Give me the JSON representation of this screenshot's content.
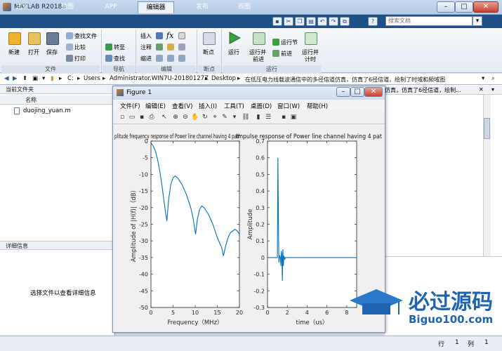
{
  "window": {
    "title": "MATLAB R2018a",
    "minimize": "–",
    "maximize": "□",
    "close": "✕"
  },
  "tabs": [
    {
      "label": "主页"
    },
    {
      "label": "绘图"
    },
    {
      "label": "APP"
    },
    {
      "label": "编辑器"
    },
    {
      "label": "发布"
    },
    {
      "label": "视图"
    }
  ],
  "search": {
    "placeholder": "搜索文档",
    "go": "▾"
  },
  "toolstrip_icons": [
    "save-icon",
    "cut-icon",
    "copy-icon",
    "paste-icon",
    "undo-icon",
    "redo-icon",
    "switch-window-icon",
    "help-icon"
  ],
  "ribbon": {
    "file": {
      "new": "新建",
      "open": "打开",
      "save": "保存",
      "find_files": "查找文件",
      "compare": "比较",
      "print": "打印",
      "section": "文件"
    },
    "navigate": {
      "goto": "转至",
      "find": "查找",
      "section": "导航"
    },
    "edit": {
      "insert": "插入",
      "comment": "注释",
      "indent": "缩进",
      "fx": "fx",
      "section": "编辑"
    },
    "breakpoints": {
      "label": "断点",
      "section": "断点"
    },
    "run": {
      "run": "运行",
      "run_advance_1": "运行并",
      "run_advance_2": "前进",
      "run_section": "运行节",
      "advance": "前进",
      "run_time_1": "运行并",
      "run_time_2": "计时",
      "section": "运行"
    }
  },
  "address": {
    "drive": "C:",
    "users": "Users",
    "user": "Administrator.WIN7U-20180127Z",
    "desktop": "Desktop",
    "folder": "在低压电力线载波通信中的多径信道仿真，仿真了6径信道，绘制了时域和频域图"
  },
  "current_folder": {
    "title": "当前文件夹",
    "column_name": "名称",
    "files": [
      {
        "name": "duojing_yuan.m"
      }
    ]
  },
  "details": {
    "title": "详细信息",
    "empty": "选择文件以查看详细信息"
  },
  "right_panel": {
    "text": "仿真，仿真了6径信道，绘制..."
  },
  "status": {
    "row_label": "行",
    "row_value": "1",
    "col_label": "列",
    "col_value": "1"
  },
  "figure": {
    "title": "Figure 1",
    "menu": [
      {
        "label": "文件(F)"
      },
      {
        "label": "编辑(E)"
      },
      {
        "label": "查看(V)"
      },
      {
        "label": "插入(I)"
      },
      {
        "label": "工具(T)"
      },
      {
        "label": "桌面(D)"
      },
      {
        "label": "窗口(W)"
      },
      {
        "label": "帮助(H)"
      }
    ]
  },
  "watermark": {
    "text": "必过源码",
    "url": "Biguo100.com"
  },
  "chart_data": [
    {
      "type": "line",
      "title": "plitude frequency response of Power line channel having 4 path",
      "xlabel": "Frequency（MHz）",
      "ylabel": "Amplitude of |H(f)|（dB）",
      "xlim": [
        0,
        20
      ],
      "ylim": [
        -50,
        0
      ],
      "xticks": [
        0,
        5,
        10,
        15,
        20
      ],
      "yticks": [
        0,
        -5,
        -10,
        -15,
        -20,
        -25,
        -30,
        -35,
        -40,
        -45,
        -50
      ],
      "grid": false,
      "x": [
        0,
        0.5,
        1,
        1.5,
        2,
        2.5,
        3,
        3.3,
        3.6,
        4,
        4.5,
        5,
        5.5,
        6,
        6.5,
        7,
        7.5,
        8,
        8.5,
        9,
        9.5,
        9.8,
        10.1,
        10.5,
        11,
        11.5,
        12,
        12.5,
        13,
        13.5,
        14,
        14.5,
        15,
        15.5,
        16,
        16.4,
        16.8,
        17.2,
        17.6,
        18,
        18.5,
        19,
        19.5,
        20
      ],
      "values": [
        -0.5,
        -1.5,
        -3,
        -5.5,
        -9,
        -13.5,
        -18.5,
        -21.5,
        -24,
        -17.5,
        -13,
        -11,
        -10.5,
        -11,
        -12,
        -13,
        -14.5,
        -16,
        -18,
        -20,
        -23,
        -25.5,
        -28,
        -23.5,
        -20.5,
        -19.5,
        -20,
        -21,
        -22,
        -23.5,
        -25,
        -27,
        -29,
        -30.5,
        -32,
        -34.5,
        -32,
        -30,
        -28.5,
        -27.5,
        -27,
        -26.5,
        -27,
        -28
      ]
    },
    {
      "type": "line",
      "title": "Impulse response of Power line channel having 4 pat",
      "xlabel": "time（us）",
      "ylabel": "Amplitude",
      "xlim": [
        0,
        9
      ],
      "ylim": [
        -0.3,
        0.7
      ],
      "xticks": [
        0,
        2,
        4,
        6,
        8
      ],
      "yticks": [
        0.7,
        0.6,
        0.5,
        0.4,
        0.3,
        0.2,
        0.1,
        0,
        -0.1,
        -0.2,
        -0.3
      ],
      "grid": false,
      "x": [
        0,
        1.0,
        1.05,
        1.1,
        1.15,
        1.2,
        1.25,
        1.3,
        1.35,
        1.4,
        1.45,
        1.5,
        1.55,
        1.6,
        1.65,
        1.7,
        1.75,
        1.8,
        2.0,
        9
      ],
      "values": [
        0,
        0,
        0.6,
        0.25,
        -0.03,
        0.0,
        0.01,
        0.0,
        -0.05,
        0.04,
        0.01,
        -0.14,
        0.05,
        -0.05,
        0.01,
        0.0,
        -0.01,
        0,
        0,
        0
      ]
    }
  ]
}
